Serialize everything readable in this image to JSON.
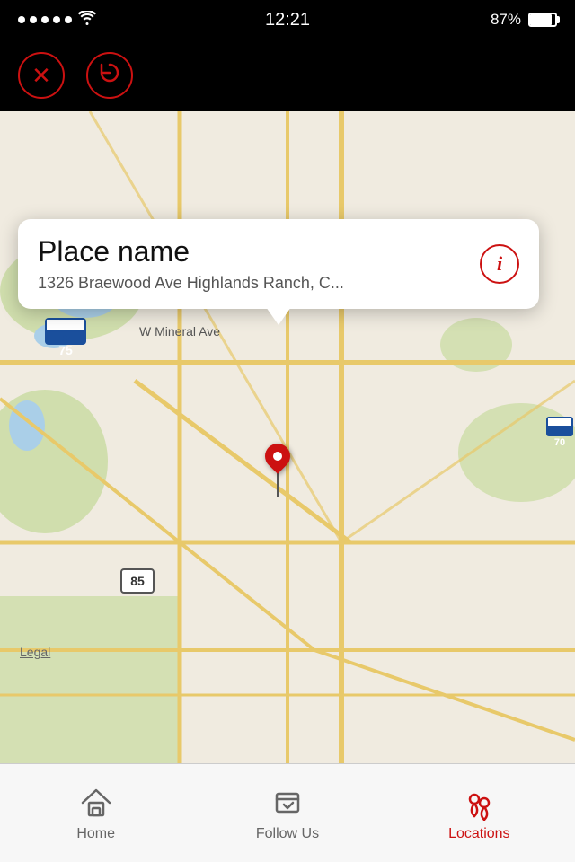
{
  "statusBar": {
    "time": "12:21",
    "battery": "87%",
    "batteryLevel": 85
  },
  "toolbar": {
    "closeBtn": "close",
    "refreshBtn": "refresh"
  },
  "popup": {
    "placeName": "Place name",
    "address": "1326 Braewood Ave Highlands Ranch, C..."
  },
  "legal": {
    "label": "Legal"
  },
  "tabBar": {
    "tabs": [
      {
        "id": "home",
        "label": "Home",
        "active": false
      },
      {
        "id": "follow",
        "label": "Follow Us",
        "active": false
      },
      {
        "id": "locations",
        "label": "Locations",
        "active": true
      }
    ]
  }
}
